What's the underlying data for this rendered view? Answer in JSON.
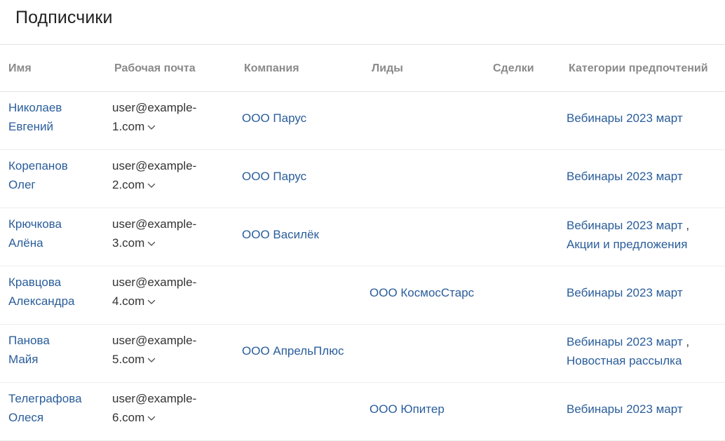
{
  "page": {
    "title": "Подписчики"
  },
  "columns": [
    "Имя",
    "Рабочая почта",
    "Компания",
    "Лиды",
    "Сделки",
    "Категории предпочтений"
  ],
  "rows": [
    {
      "name": [
        "Николаев",
        "Евгений"
      ],
      "email": [
        "user@example-",
        "1.com"
      ],
      "company": "ООО Парус",
      "lead": "",
      "deal": "",
      "categories": [
        "Вебинары 2023 март"
      ]
    },
    {
      "name": [
        "Корепанов",
        "Олег"
      ],
      "email": [
        "user@example-",
        "2.com"
      ],
      "company": "ООО Парус",
      "lead": "",
      "deal": "",
      "categories": [
        "Вебинары 2023 март"
      ]
    },
    {
      "name": [
        "Крючкова",
        "Алёна"
      ],
      "email": [
        "user@example-",
        "3.com"
      ],
      "company": "ООО Василёк",
      "lead": "",
      "deal": "",
      "categories": [
        "Вебинары 2023 март",
        "Акции и предложения"
      ]
    },
    {
      "name": [
        "Кравцова",
        "Александра"
      ],
      "email": [
        "user@example-",
        "4.com"
      ],
      "company": "",
      "lead": "ООО КосмосСтарс",
      "deal": "",
      "categories": [
        "Вебинары 2023 март"
      ]
    },
    {
      "name": [
        "Панова",
        "Майя"
      ],
      "email": [
        "user@example-",
        "5.com"
      ],
      "company": "ООО АпрельПлюс",
      "lead": "",
      "deal": "",
      "categories": [
        "Вебинары 2023 март",
        "Новостная рассылка"
      ]
    },
    {
      "name": [
        "Телеграфова",
        "Олеся"
      ],
      "email": [
        "user@example-",
        "6.com"
      ],
      "company": "",
      "lead": "ООО Юпитер",
      "deal": "",
      "categories": [
        "Вебинары 2023 март"
      ]
    }
  ],
  "colors": {
    "link": "#2a5d9b",
    "header_text": "#8a8a8a",
    "divider": "#e2e2e2"
  },
  "icons": {
    "email_dropdown": "chevron-down-icon"
  }
}
